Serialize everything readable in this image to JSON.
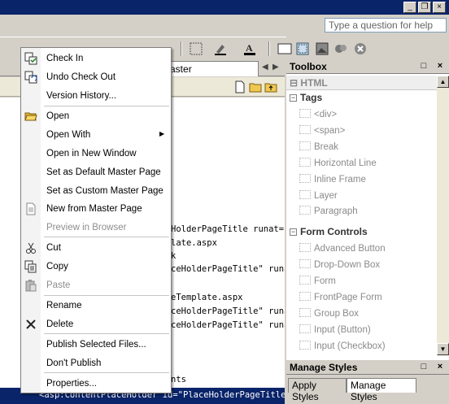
{
  "window": {
    "min_label": "_",
    "restore_label": "❐",
    "close_label": "×"
  },
  "help": {
    "placeholder": "Type a question for help"
  },
  "tab": {
    "label": "Flyouts.master",
    "nav_left": "◀",
    "nav_right": "▶"
  },
  "editor": {
    "lines": [
      "HolderPageTitle runat=\"s...",
      "late.aspx",
      "k",
      "ceHolderPageTitle\" runat=...",
      "eTemplate.aspx",
      "ceHolderPageTitle\" runat=...",
      "ceHolderPageTitle\" runat=...",
      "nts"
    ],
    "selected_line": "<asp:ContentPlaceHolder id=\"PlaceHolderPageTitle\" runat=..."
  },
  "context_menu": {
    "items": [
      {
        "label": "Check In",
        "icon": "check-in-icon",
        "enabled": true
      },
      {
        "label": "Undo Check Out",
        "icon": "undo-check-out-icon",
        "enabled": true
      },
      {
        "label": "Version History...",
        "icon": "",
        "enabled": true
      },
      {
        "label": "Open",
        "icon": "open-folder-icon",
        "enabled": true
      },
      {
        "label": "Open With",
        "icon": "",
        "enabled": true,
        "submenu": true
      },
      {
        "label": "Open in New Window",
        "icon": "",
        "enabled": true
      },
      {
        "label": "Set as Default Master Page",
        "icon": "",
        "enabled": true
      },
      {
        "label": "Set as Custom Master Page",
        "icon": "",
        "enabled": true
      },
      {
        "label": "New from Master Page",
        "icon": "new-page-icon",
        "enabled": true
      },
      {
        "label": "Preview in Browser",
        "icon": "",
        "enabled": false
      },
      {
        "label": "Cut",
        "icon": "scissors-icon",
        "enabled": true
      },
      {
        "label": "Copy",
        "icon": "copy-icon",
        "enabled": true
      },
      {
        "label": "Paste",
        "icon": "paste-icon",
        "enabled": false
      },
      {
        "label": "Rename",
        "icon": "",
        "enabled": true
      },
      {
        "label": "Delete",
        "icon": "delete-x-icon",
        "enabled": true
      },
      {
        "label": "Publish Selected Files...",
        "icon": "",
        "enabled": true
      },
      {
        "label": "Don't Publish",
        "icon": "",
        "enabled": true
      },
      {
        "label": "Properties...",
        "icon": "",
        "enabled": true
      }
    ],
    "submenu_arrow": "▶"
  },
  "toolbox": {
    "title": "Toolbox",
    "html_header": "HTML",
    "tags_header": "Tags",
    "tags": [
      "<div>",
      "<span>",
      "Break",
      "Horizontal Line",
      "Inline Frame",
      "Layer",
      "Paragraph"
    ],
    "forms_header": "Form Controls",
    "forms": [
      "Advanced Button",
      "Drop-Down Box",
      "Form",
      "FrontPage Form",
      "Group Box",
      "Input (Button)",
      "Input (Checkbox)"
    ],
    "collapse_glyph": "⊟",
    "minus_glyph": "−",
    "scroll_up": "▲",
    "scroll_down": "▼",
    "panel_btns": {
      "dock": "□",
      "close": "×"
    }
  },
  "styles_panel": {
    "title": "Manage Styles",
    "tabs": [
      "Apply Styles",
      "Manage Styles"
    ],
    "active_tab": "Manage Styles"
  },
  "colors": {
    "title_bar": "#0a246a",
    "selection": "#0a246a",
    "disabled_text": "#8d8d8d"
  }
}
